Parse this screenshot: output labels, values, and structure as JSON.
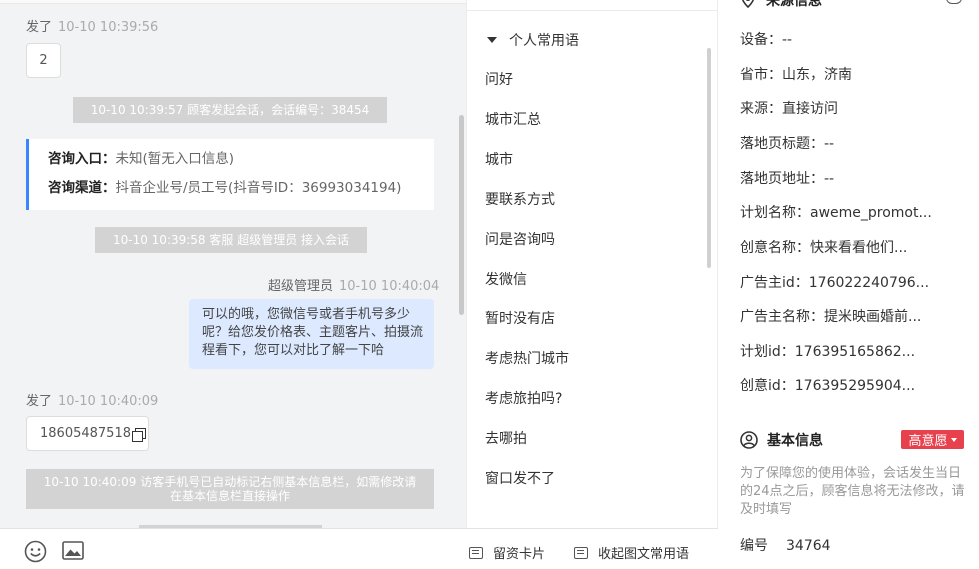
{
  "chat": {
    "msg1": {
      "sender": "发了",
      "time": "10-10 10:39:56",
      "text": "2"
    },
    "sys1": "10-10 10:39:57 顾客发起会话，会话编号：38454",
    "consult": {
      "entry_label": "咨询入口：",
      "entry_value": "未知(暂无入口信息)",
      "channel_label": "咨询渠道：",
      "channel_value": "抖音企业号/员工号(抖音号ID：36993034194)"
    },
    "sys2": "10-10 10:39:58 客服 超级管理员 接入会话",
    "agent_msg": {
      "sender": "超级管理员",
      "time": "10-10 10:40:04",
      "text": "可以的哦，您微信号或者手机号多少呢？给您发价格表、主题客片、拍摄流程看下，您可以对比了解一下哈"
    },
    "msg2": {
      "sender": "发了",
      "time": "10-10 10:40:09",
      "text": "18605487518"
    },
    "sys3": "10-10 10:40:09 访客手机号已自动标记右侧基本信息栏，如需修改请在基本信息栏直接操作"
  },
  "toolbar": {
    "card_label": "留资卡片",
    "collapse_label": "收起图文常用语"
  },
  "phrases": {
    "group": "个人常用语",
    "items": [
      "问好",
      "城市汇总",
      "城市",
      "要联系方式",
      "问是咨询吗",
      "发微信",
      "暂时没有店",
      "考虑热门城市",
      "考虑旅拍吗?",
      "去哪拍",
      "窗口发不了"
    ]
  },
  "info": {
    "source_title": "来源信息",
    "rows": [
      "设备：--",
      "省市：山东，济南",
      "来源：直接访问",
      "落地页标题：--",
      "落地页地址：--",
      "计划名称：aweme_promot...",
      "创意名称：快来看看他们...",
      "广告主id：176022240796...",
      "广告主名称：提米映画婚前...",
      "计划id：176395165862...",
      "创意id：176395295904..."
    ],
    "basic_title": "基本信息",
    "intent_badge": "高意愿",
    "notice": "为了保障您的使用体验，会话发生当日的24点之后，顾客信息将无法修改，请及时填写",
    "id_label": "编号",
    "id_value": "34764"
  },
  "colors": {
    "accent": "#3a86ff",
    "badge": "#e8414e",
    "agent_bubble": "#dce9ff"
  }
}
